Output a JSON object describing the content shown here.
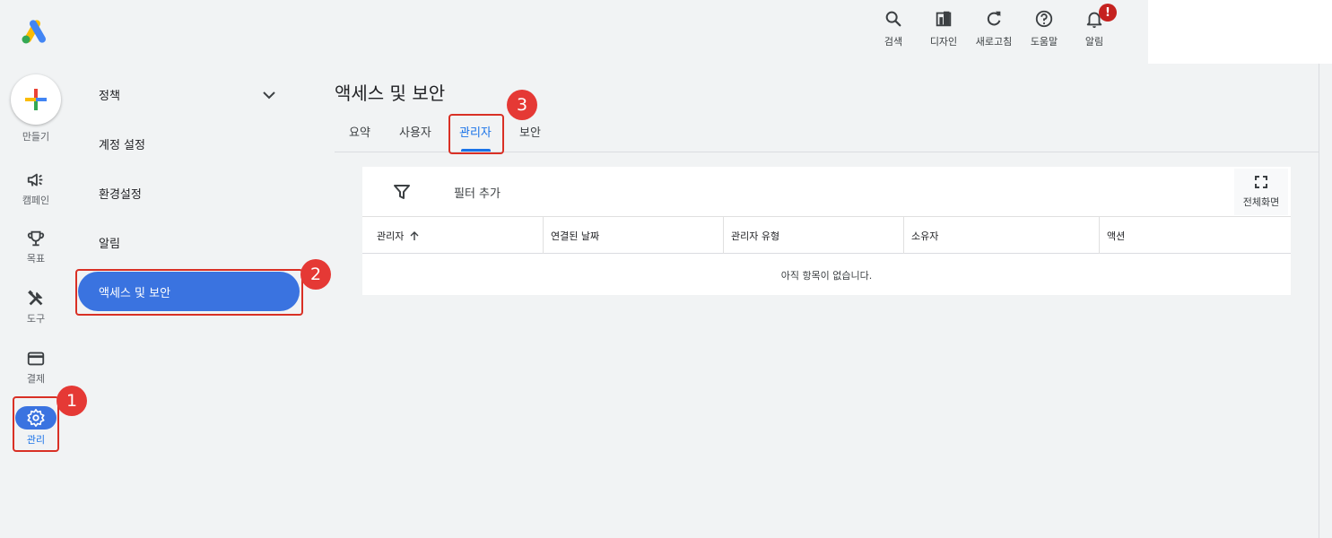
{
  "top_actions": [
    {
      "label": "검색",
      "icon": "search-icon"
    },
    {
      "label": "디자인",
      "icon": "design-icon"
    },
    {
      "label": "새로고침",
      "icon": "refresh-icon"
    },
    {
      "label": "도움말",
      "icon": "help-icon"
    },
    {
      "label": "알림",
      "icon": "bell-icon",
      "badge": "!"
    }
  ],
  "rail": {
    "create_label": "만들기",
    "items": [
      {
        "label": "캠페인",
        "icon": "megaphone-icon"
      },
      {
        "label": "목표",
        "icon": "trophy-icon"
      },
      {
        "label": "도구",
        "icon": "tools-icon"
      },
      {
        "label": "결제",
        "icon": "credit-card-icon"
      },
      {
        "label": "관리",
        "icon": "gear-icon",
        "active": true
      }
    ]
  },
  "subnav": {
    "items": [
      {
        "label": "정책",
        "expandable": true
      },
      {
        "label": "계정 설정"
      },
      {
        "label": "환경설정"
      },
      {
        "label": "알림"
      },
      {
        "label": "액세스 및 보안",
        "active": true
      }
    ]
  },
  "page": {
    "title": "액세스 및 보안",
    "tabs": [
      {
        "label": "요약"
      },
      {
        "label": "사용자"
      },
      {
        "label": "관리자",
        "active": true
      },
      {
        "label": "보안"
      }
    ]
  },
  "table": {
    "filter_label": "필터 추가",
    "fullscreen_label": "전체화면",
    "columns": [
      "관리자",
      "연결된 날짜",
      "관리자 유형",
      "소유자",
      "액션"
    ],
    "empty_message": "아직 항목이 없습니다."
  },
  "annotations": [
    "1",
    "2",
    "3"
  ],
  "colors": {
    "accent": "#1a73e8",
    "active_fill": "#3a73e0",
    "marker": "#e53935"
  }
}
